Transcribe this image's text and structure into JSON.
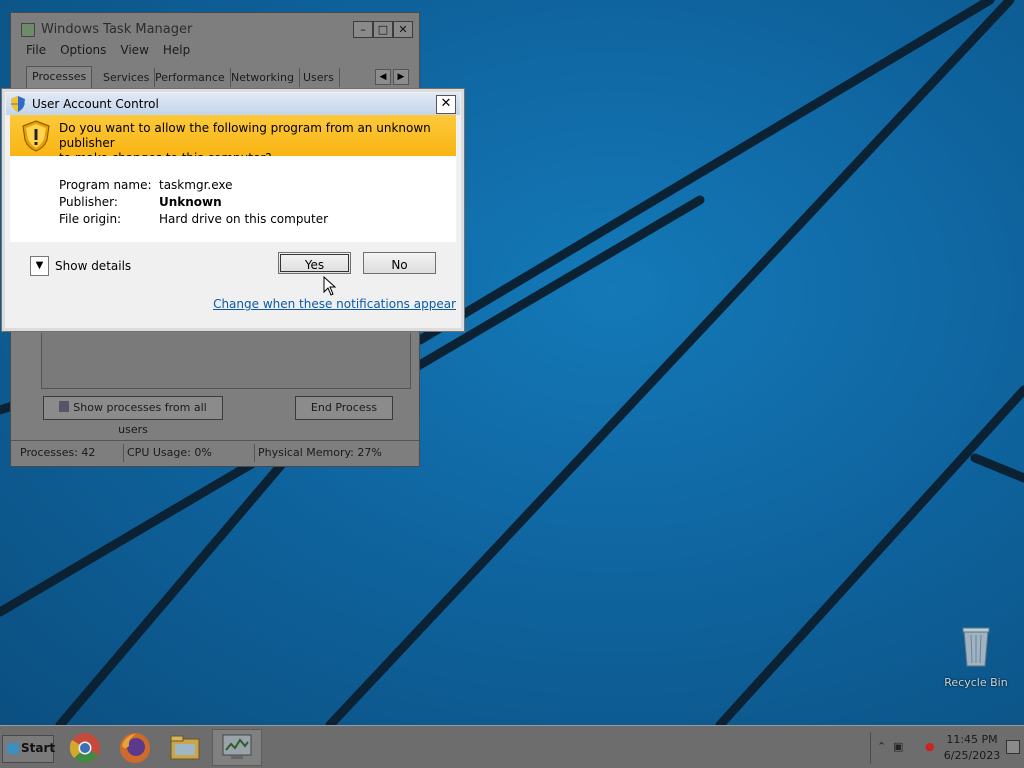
{
  "taskmgr": {
    "title": "Windows Task Manager",
    "menu": [
      "File",
      "Options",
      "View",
      "Help"
    ],
    "tabs": [
      "Processes",
      "Services",
      "Performance",
      "Networking",
      "Users"
    ],
    "show_processes_label": "Show processes from all users",
    "end_process_label": "End Process",
    "status": {
      "processes": "Processes: 42",
      "cpu": "CPU Usage: 0%",
      "memory": "Physical Memory: 27%"
    }
  },
  "uac": {
    "title": "User Account Control",
    "question_line1": "Do you want to allow the following program from an unknown publisher",
    "question_line2": "to make changes to this computer?",
    "program_name_label": "Program name:",
    "program_name": "taskmgr.exe",
    "publisher_label": "Publisher:",
    "publisher": "Unknown",
    "file_origin_label": "File origin:",
    "file_origin": "Hard drive on this computer",
    "show_details": "Show details",
    "yes": "Yes",
    "no": "No",
    "change_link": "Change when these notifications appear"
  },
  "desktop": {
    "recycle_bin": "Recycle Bin"
  },
  "taskbar": {
    "start_label": "Start",
    "pinned_icons": [
      "chrome-icon",
      "firefox-icon",
      "file-explorer-icon",
      "task-manager-icon"
    ],
    "time": "11:45 PM",
    "date": "6/25/2023"
  },
  "colors": {
    "desktop_blue": "#0f65a0",
    "uac_banner": "#f9b513",
    "link": "#0b5aa8",
    "taskbar": "#6d6d6d"
  }
}
